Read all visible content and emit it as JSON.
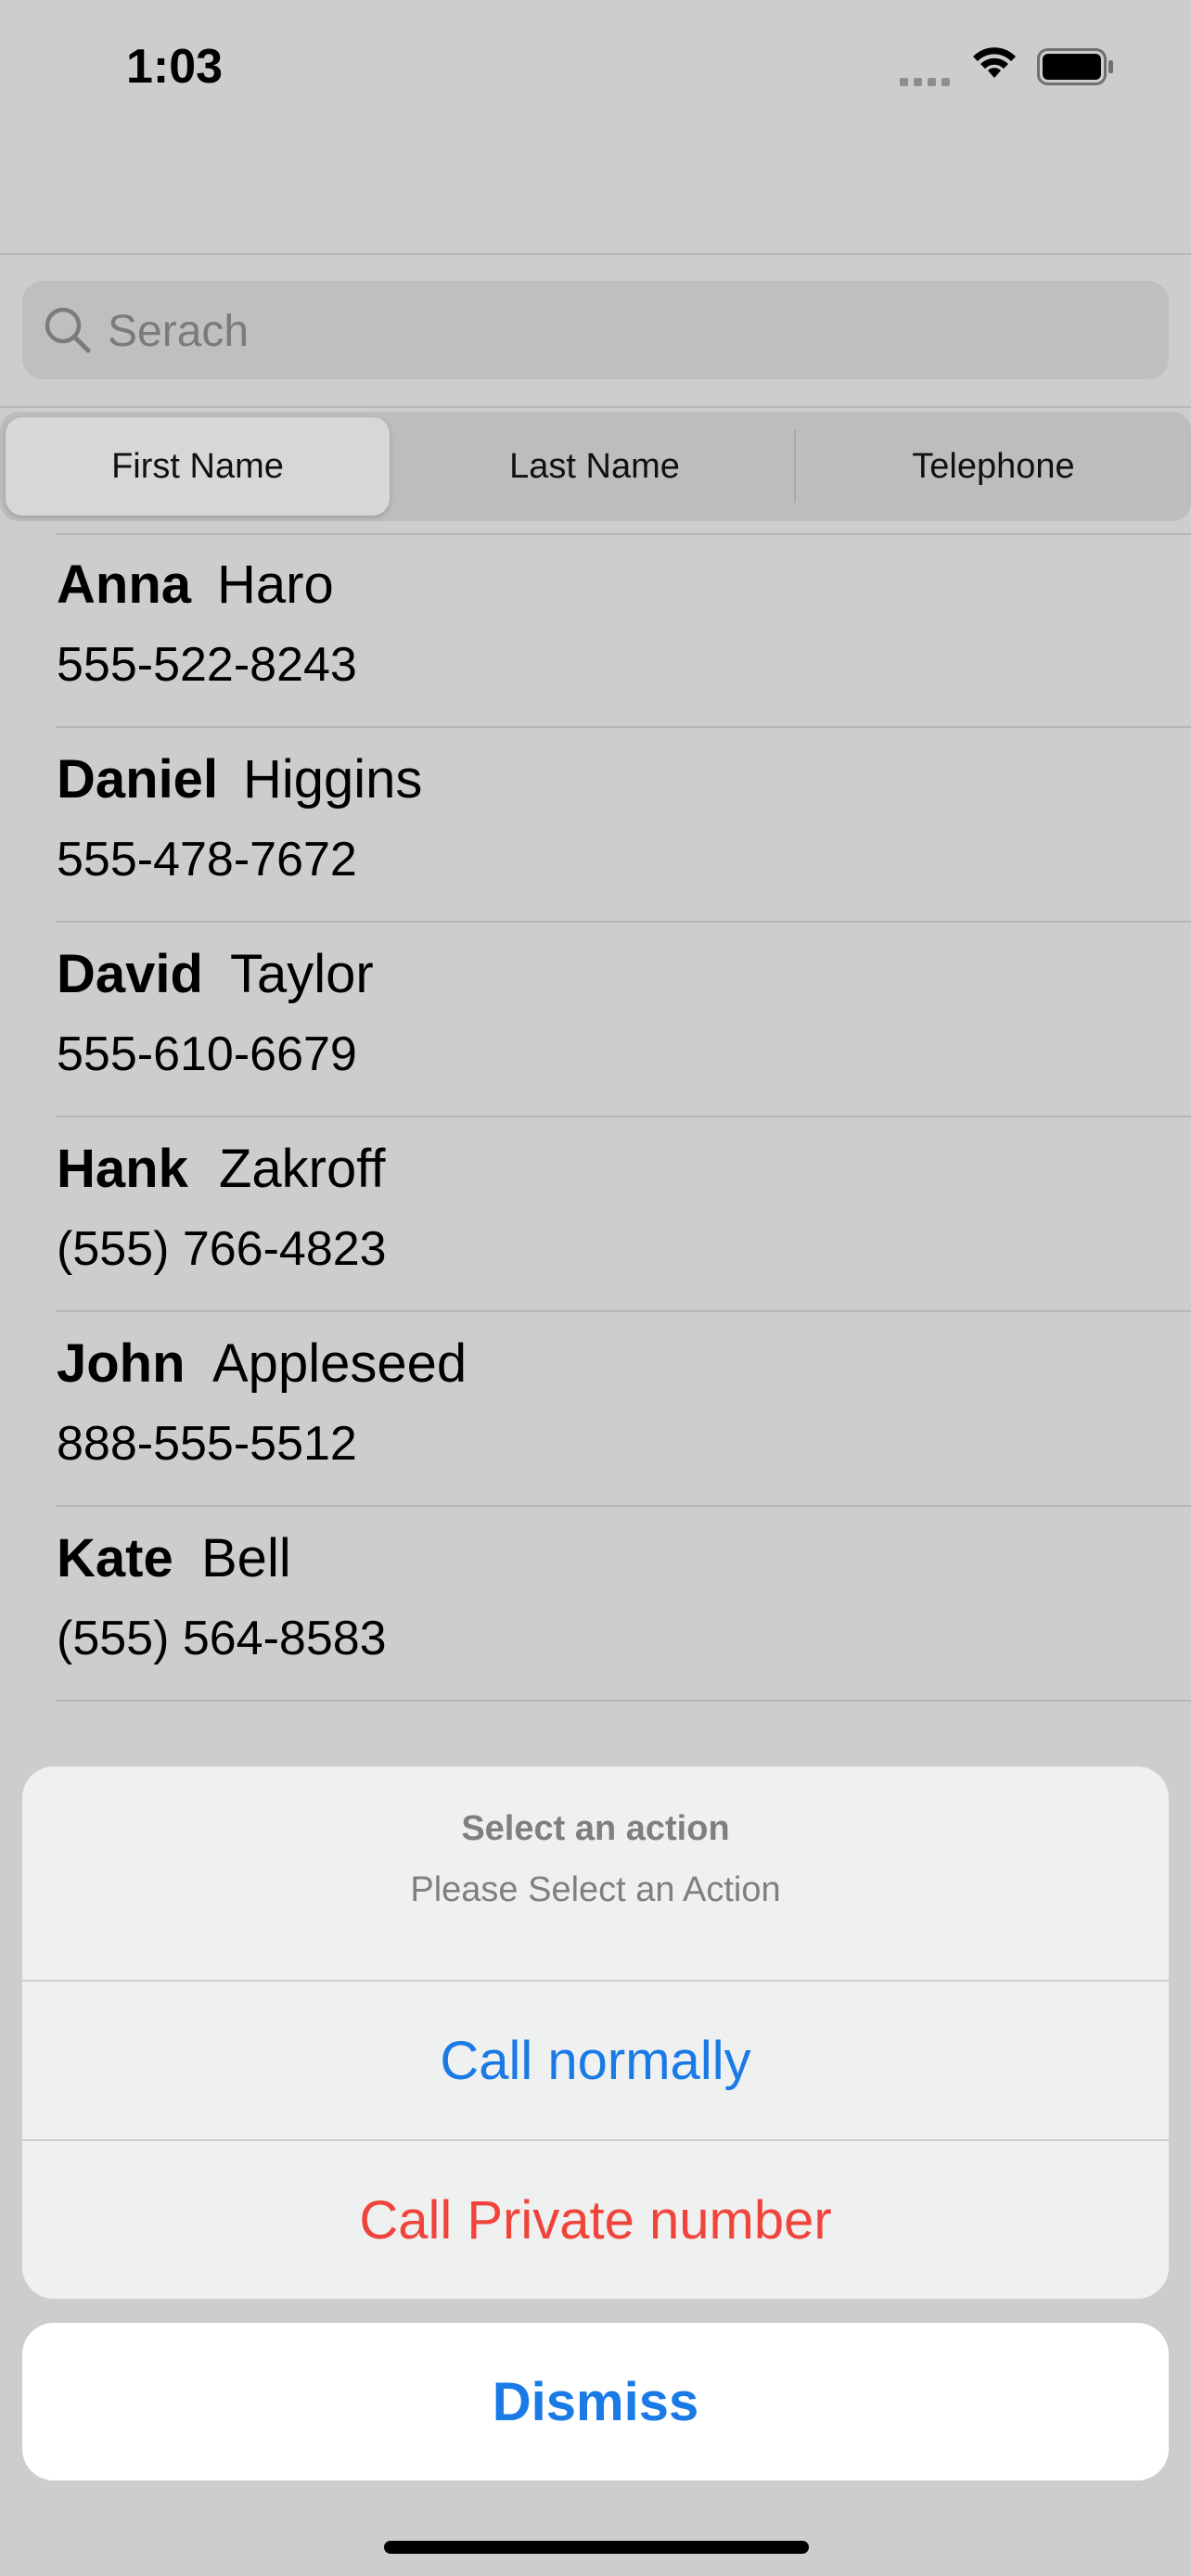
{
  "status_bar": {
    "time": "1:03"
  },
  "search": {
    "placeholder": "Serach"
  },
  "segments": {
    "first_name": "First Name",
    "last_name": "Last Name",
    "telephone": "Telephone",
    "selected": "first_name"
  },
  "contacts": [
    {
      "first": "Anna",
      "last": "Haro",
      "phone": "555-522-8243"
    },
    {
      "first": "Daniel",
      "last": "Higgins",
      "phone": "555-478-7672"
    },
    {
      "first": "David",
      "last": "Taylor",
      "phone": "555-610-6679"
    },
    {
      "first": "Hank",
      "last": "Zakroff",
      "phone": "(555) 766-4823"
    },
    {
      "first": "John",
      "last": "Appleseed",
      "phone": "888-555-5512"
    },
    {
      "first": "Kate",
      "last": "Bell",
      "phone": "(555) 564-8583"
    }
  ],
  "action_sheet": {
    "title": "Select an action",
    "message": "Please Select an Action",
    "call_normally": "Call normally",
    "call_private": "Call Private number",
    "dismiss": "Dismiss"
  },
  "colors": {
    "accent_blue": "#1a7ae6",
    "destructive_red": "#f0443b",
    "dim_background": "#cdcdcd"
  }
}
